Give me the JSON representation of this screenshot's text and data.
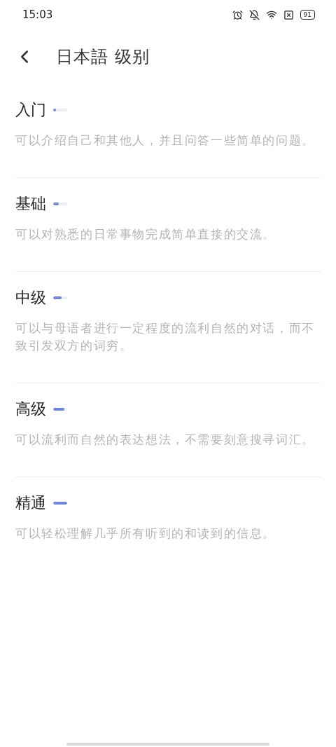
{
  "status_bar": {
    "time": "15:03",
    "battery": "91"
  },
  "header": {
    "title": "日本語 级别"
  },
  "levels": [
    {
      "name": "入门",
      "level": 0.2,
      "description": "可以介绍自己和其他人，并且问答一些简单的问题。"
    },
    {
      "name": "基础",
      "level": 0.4,
      "description": "可以对熟悉的日常事物完成简单直接的交流。"
    },
    {
      "name": "中级",
      "level": 0.6,
      "description": "可以与母语者进行一定程度的流利自然的对话，而不致引发双方的词穷。"
    },
    {
      "name": "高级",
      "level": 0.8,
      "description": "可以流利而自然的表达想法，不需要刻意搜寻词汇。"
    },
    {
      "name": "精通",
      "level": 1,
      "description": "可以轻松理解几乎所有听到的和读到的信息。"
    }
  ]
}
